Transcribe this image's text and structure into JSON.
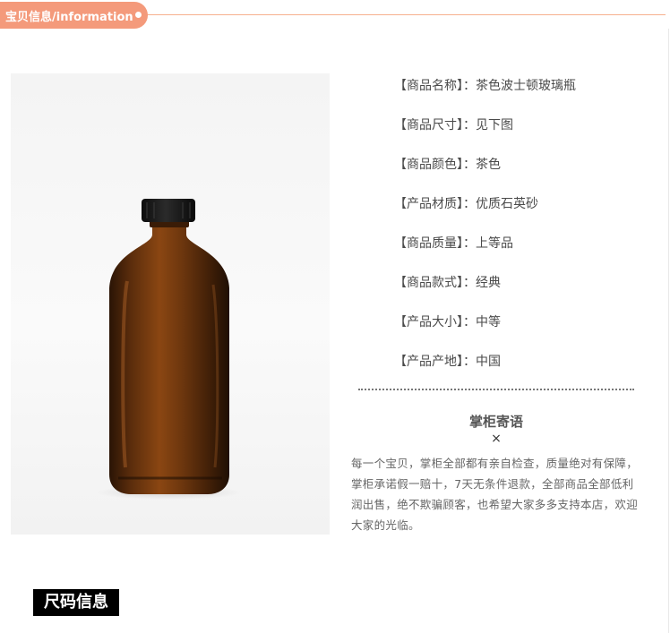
{
  "header": {
    "title": "宝贝信息/information"
  },
  "product": {
    "image_icon": "amber-bottle-photo",
    "specs": [
      {
        "label": "【商品名称】：",
        "value": "茶色波士顿玻璃瓶"
      },
      {
        "label": "【商品尺寸】：",
        "value": "见下图"
      },
      {
        "label": "【商品颜色】：",
        "value": "茶色"
      },
      {
        "label": "【产品材质】：",
        "value": "优质石英砂"
      },
      {
        "label": "【商品质量】：",
        "value": "上等品"
      },
      {
        "label": "【商品款式】：",
        "value": "经典"
      },
      {
        "label": "【产品大小】：",
        "value": "中等"
      },
      {
        "label": "【产品产地】：",
        "value": "中国"
      }
    ]
  },
  "note": {
    "title": "掌柜寄语",
    "close": "×",
    "body": "每一个宝贝，掌柜全部都有亲自检查，质量绝对有保障，掌柜承诺假一赔十，7天无条件退款，全部商品全部低利润出售，绝不欺骗顾客，也希望大家多多支持本店，欢迎大家的光临。"
  },
  "size_section": {
    "label": "尺码信息"
  },
  "colors": {
    "accent": "#f49a7b",
    "text": "#4a4a4a"
  }
}
